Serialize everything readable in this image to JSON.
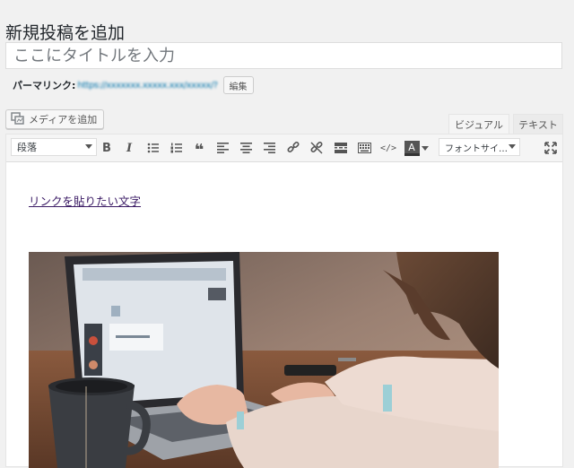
{
  "page": {
    "title": "新規投稿を追加"
  },
  "post_title": {
    "placeholder": "ここにタイトルを入力",
    "value": ""
  },
  "permalink": {
    "label": "パーマリンク:",
    "url": "https://xxxxxxx.xxxxx.xxx/xxxxx/?",
    "edit_button": "編集"
  },
  "media": {
    "button_label": "メディアを追加",
    "icon": "add-media-icon"
  },
  "editor_tabs": {
    "visual": "ビジュアル",
    "text": "テキスト"
  },
  "toolbar": {
    "format_select": "段落",
    "font_size_select": "フォントサイ…",
    "buttons": [
      "bold",
      "italic",
      "bullet-list",
      "numbered-list",
      "blockquote",
      "align-left",
      "align-center",
      "align-right",
      "insert-link",
      "remove-link",
      "read-more",
      "toolbar-toggle",
      "code",
      "text-color",
      "text-color-dropdown",
      "fullscreen"
    ],
    "bold_glyph": "B",
    "italic_glyph": "I",
    "quote_glyph": "❝",
    "code_glyph": "</>",
    "text_color_glyph": "A",
    "colors": {
      "text_color_bar": "#333333"
    }
  },
  "content": {
    "link_text": "リンクを貼りたい文字",
    "image_alt": "ノートパソコンで作業する人"
  }
}
